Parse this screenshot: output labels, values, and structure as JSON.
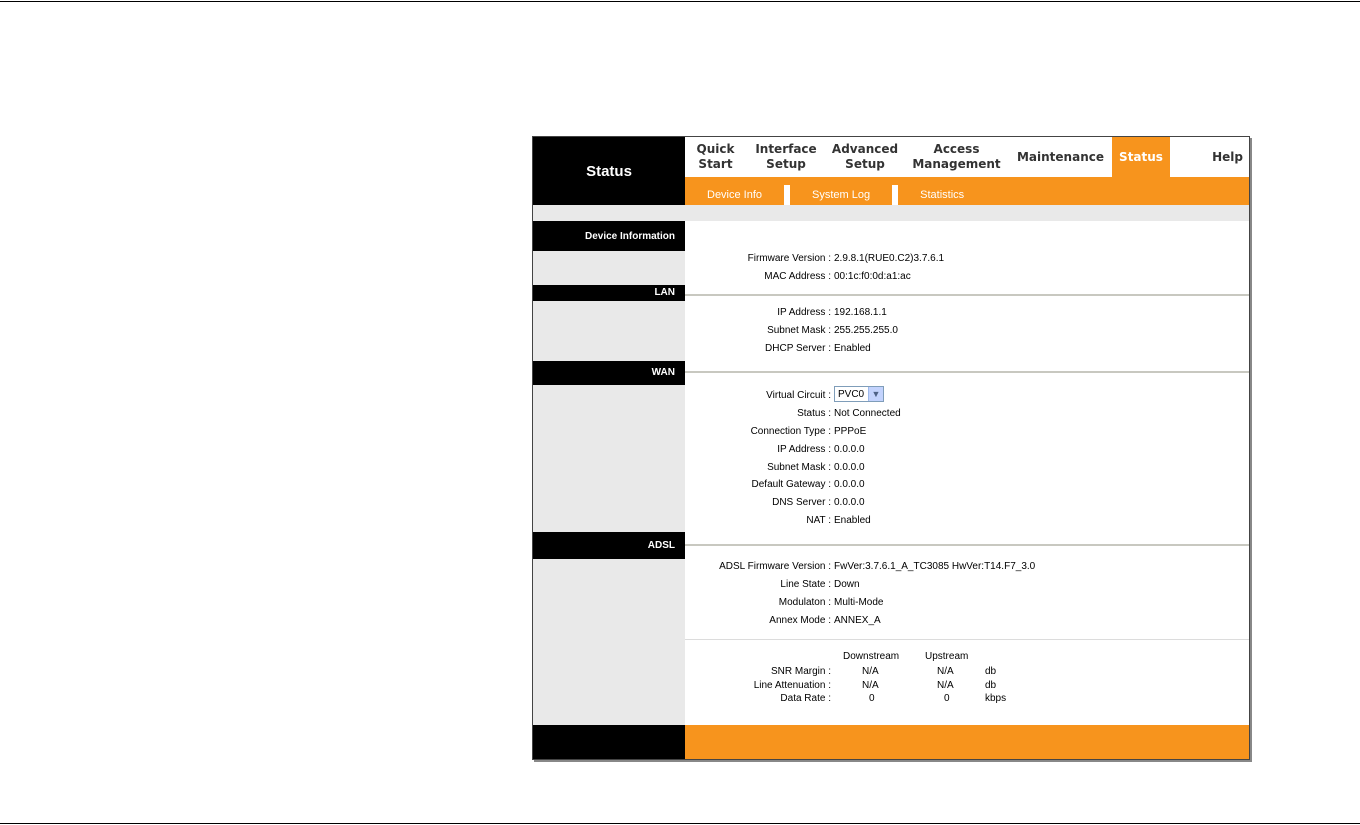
{
  "brand": "Status",
  "nav": [
    "Quick\nStart",
    "Interface\nSetup",
    "Advanced\nSetup",
    "Access\nManagement",
    "Maintenance",
    "Status",
    "Help"
  ],
  "subnav": [
    "Device Info",
    "System Log",
    "Statistics"
  ],
  "sections": {
    "device": "Device Information",
    "lan": "LAN",
    "wan": "WAN",
    "adsl": "ADSL"
  },
  "device": {
    "firmware_label": "Firmware Version :",
    "firmware": "2.9.8.1(RUE0.C2)3.7.6.1",
    "mac_label": "MAC Address :",
    "mac": "00:1c:f0:0d:a1:ac"
  },
  "lan": {
    "ip_label": "IP Address :",
    "ip": "192.168.1.1",
    "mask_label": "Subnet Mask :",
    "mask": "255.255.255.0",
    "dhcp_label": "DHCP Server :",
    "dhcp": "Enabled"
  },
  "wan": {
    "vc_label": "Virtual Circuit :",
    "vc": "PVC0",
    "status_label": "Status :",
    "status": "Not Connected",
    "ctype_label": "Connection Type :",
    "ctype": "PPPoE",
    "ip_label": "IP Address :",
    "ip": "0.0.0.0",
    "mask_label": "Subnet Mask :",
    "mask": "0.0.0.0",
    "gw_label": "Default Gateway :",
    "gw": "0.0.0.0",
    "dns_label": "DNS Server :",
    "dns": "0.0.0.0",
    "nat_label": "NAT :",
    "nat": "Enabled"
  },
  "adsl": {
    "fw_label": "ADSL Firmware Version :",
    "fw": "FwVer:3.7.6.1_A_TC3085 HwVer:T14.F7_3.0",
    "line_label": "Line State :",
    "line": "Down",
    "mod_label": "Modulaton :",
    "mod": "Multi-Mode",
    "annex_label": "Annex Mode :",
    "annex": "ANNEX_A",
    "table": {
      "col_down": "Downstream",
      "col_up": "Upstream",
      "rows": [
        {
          "label": "SNR Margin :",
          "down": "N/A",
          "up": "N/A",
          "unit": "db"
        },
        {
          "label": "Line Attenuation :",
          "down": "N/A",
          "up": "N/A",
          "unit": "db"
        },
        {
          "label": "Data Rate :",
          "down": "0",
          "up": "0",
          "unit": "kbps"
        }
      ]
    }
  }
}
